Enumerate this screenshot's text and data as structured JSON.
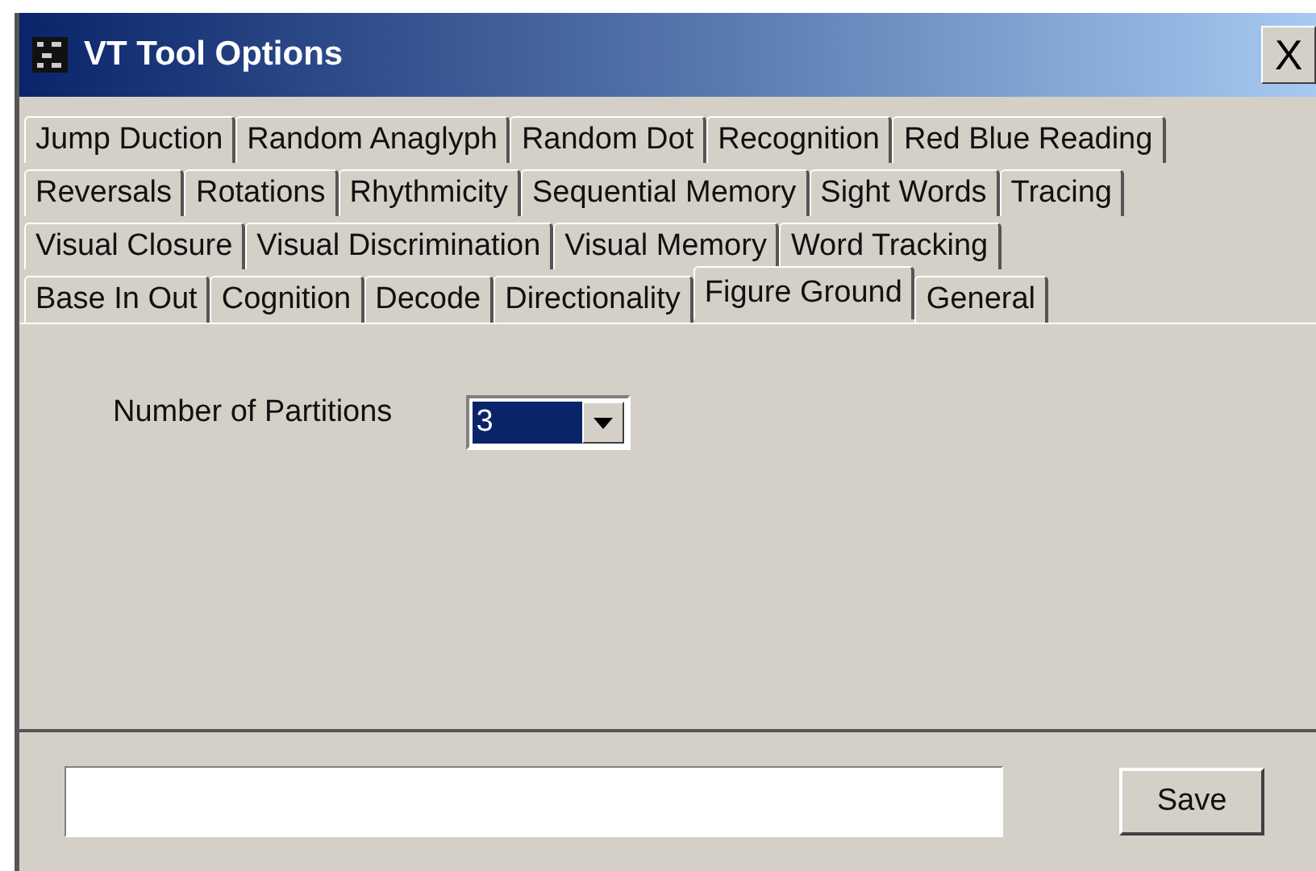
{
  "window": {
    "title": "VT Tool Options",
    "close": "X"
  },
  "tab_rows": [
    {
      "tabs": [
        {
          "label": "Jump Duction",
          "selected": false
        },
        {
          "label": "Random Anaglyph",
          "selected": false
        },
        {
          "label": "Random Dot",
          "selected": false
        },
        {
          "label": "Recognition",
          "selected": false
        },
        {
          "label": "Red Blue Reading",
          "selected": false
        }
      ]
    },
    {
      "tabs": [
        {
          "label": "Reversals",
          "selected": false
        },
        {
          "label": "Rotations",
          "selected": false
        },
        {
          "label": "Rhythmicity",
          "selected": false
        },
        {
          "label": "Sequential Memory",
          "selected": false
        },
        {
          "label": "Sight Words",
          "selected": false
        },
        {
          "label": "Tracing",
          "selected": false
        }
      ]
    },
    {
      "tabs": [
        {
          "label": "Visual Closure",
          "selected": false
        },
        {
          "label": "Visual Discrimination",
          "selected": false
        },
        {
          "label": "Visual Memory",
          "selected": false
        },
        {
          "label": "Word Tracking",
          "selected": false
        }
      ]
    },
    {
      "tabs": [
        {
          "label": "Base In Out",
          "selected": false
        },
        {
          "label": "Cognition",
          "selected": false
        },
        {
          "label": "Decode",
          "selected": false
        },
        {
          "label": "Directionality",
          "selected": false
        },
        {
          "label": "Figure Ground",
          "selected": true
        },
        {
          "label": "General",
          "selected": false
        }
      ]
    }
  ],
  "settings": {
    "label": "Number of Partitions",
    "value": "3"
  },
  "footer": {
    "button": "Save"
  }
}
